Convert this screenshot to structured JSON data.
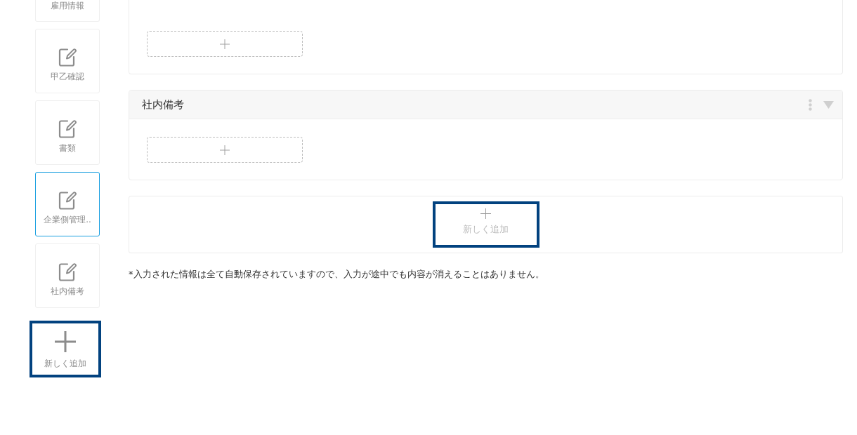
{
  "sidebar": {
    "items": [
      {
        "label": "雇用情報",
        "partial": true,
        "selected": false
      },
      {
        "label": "甲乙確認",
        "partial": false,
        "selected": false
      },
      {
        "label": "書類",
        "partial": false,
        "selected": false
      },
      {
        "label": "企業側管理..",
        "partial": false,
        "selected": true
      },
      {
        "label": "社内備考",
        "partial": false,
        "selected": false
      }
    ],
    "add_button": {
      "label": "新しく追加",
      "highlighted": true
    }
  },
  "sections": [
    {
      "partial": true
    },
    {
      "partial": false,
      "title": "社内備考"
    }
  ],
  "add_section": {
    "label": "新しく追加",
    "highlighted": true
  },
  "note": "*入力された情報は全て自動保存されていますので、入力が途中でも内容が消えることはありません。"
}
